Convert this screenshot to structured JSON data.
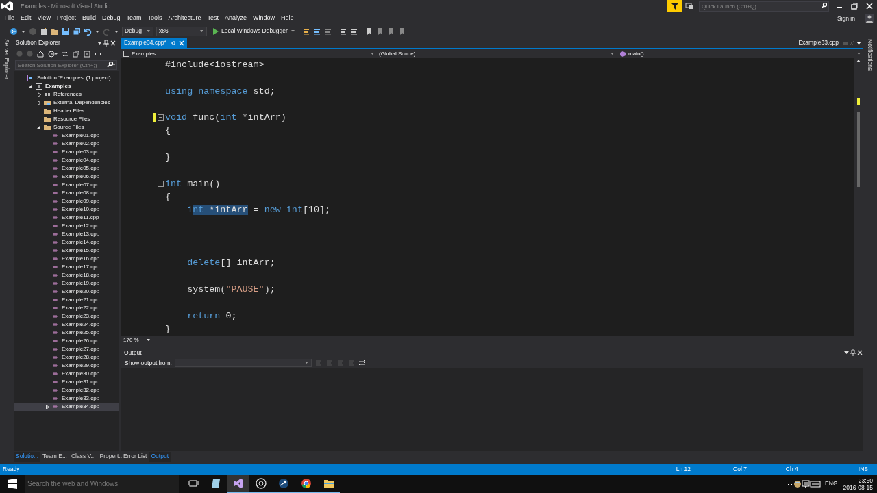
{
  "window": {
    "title": "Examples - Microsoft Visual Studio"
  },
  "quick_launch": {
    "placeholder": "Quick Launch (Ctrl+Q)"
  },
  "menu": [
    "File",
    "Edit",
    "View",
    "Project",
    "Build",
    "Debug",
    "Team",
    "Tools",
    "Architecture",
    "Test",
    "Analyze",
    "Window",
    "Help"
  ],
  "account": {
    "label": "Sign in"
  },
  "toolbar": {
    "configuration": "Debug",
    "platform": "x86",
    "debugger": "Local Windows Debugger"
  },
  "left_strip": {
    "label": "Server Explorer"
  },
  "right_strip": {
    "label": "Notifications"
  },
  "solution_explorer": {
    "title": "Solution Explorer",
    "search": {
      "placeholder": "Search Solution Explorer (Ctrl+;)"
    },
    "tree": [
      {
        "label": "Solution 'Examples' (1 project)",
        "kind": "solution",
        "selected": false,
        "children": [
          {
            "label": "Examples",
            "kind": "project",
            "expanded": true,
            "selected": false,
            "children": [
              {
                "label": "References",
                "kind": "references",
                "expanded": false,
                "selected": false
              },
              {
                "label": "External Dependencies",
                "kind": "dependencies",
                "expanded": false,
                "selected": false
              },
              {
                "label": "Header Files",
                "kind": "folder",
                "selected": false
              },
              {
                "label": "Resource Files",
                "kind": "folder",
                "selected": false
              },
              {
                "label": "Source Files",
                "kind": "folder",
                "expanded": true,
                "selected": false,
                "children": [
                  {
                    "label": "Example01.cpp",
                    "kind": "file",
                    "selected": false
                  },
                  {
                    "label": "Example02.cpp",
                    "kind": "file",
                    "selected": false
                  },
                  {
                    "label": "Example03.cpp",
                    "kind": "file",
                    "selected": false
                  },
                  {
                    "label": "Example04.cpp",
                    "kind": "file",
                    "selected": false
                  },
                  {
                    "label": "Example05.cpp",
                    "kind": "file",
                    "selected": false
                  },
                  {
                    "label": "Example06.cpp",
                    "kind": "file",
                    "selected": false
                  },
                  {
                    "label": "Example07.cpp",
                    "kind": "file",
                    "selected": false
                  },
                  {
                    "label": "Example08.cpp",
                    "kind": "file",
                    "selected": false
                  },
                  {
                    "label": "Example09.cpp",
                    "kind": "file",
                    "selected": false
                  },
                  {
                    "label": "Example10.cpp",
                    "kind": "file",
                    "selected": false
                  },
                  {
                    "label": "Example11.cpp",
                    "kind": "file",
                    "selected": false
                  },
                  {
                    "label": "Example12.cpp",
                    "kind": "file",
                    "selected": false
                  },
                  {
                    "label": "Example13.cpp",
                    "kind": "file",
                    "selected": false
                  },
                  {
                    "label": "Example14.cpp",
                    "kind": "file",
                    "selected": false
                  },
                  {
                    "label": "Example15.cpp",
                    "kind": "file",
                    "selected": false
                  },
                  {
                    "label": "Example16.cpp",
                    "kind": "file",
                    "selected": false
                  },
                  {
                    "label": "Example17.cpp",
                    "kind": "file",
                    "selected": false
                  },
                  {
                    "label": "Example18.cpp",
                    "kind": "file",
                    "selected": false
                  },
                  {
                    "label": "Example19.cpp",
                    "kind": "file",
                    "selected": false
                  },
                  {
                    "label": "Example20.cpp",
                    "kind": "file",
                    "selected": false
                  },
                  {
                    "label": "Example21.cpp",
                    "kind": "file",
                    "selected": false
                  },
                  {
                    "label": "Example22.cpp",
                    "kind": "file",
                    "selected": false
                  },
                  {
                    "label": "Example23.cpp",
                    "kind": "file",
                    "selected": false
                  },
                  {
                    "label": "Example24.cpp",
                    "kind": "file",
                    "selected": false
                  },
                  {
                    "label": "Example25.cpp",
                    "kind": "file",
                    "selected": false
                  },
                  {
                    "label": "Example26.cpp",
                    "kind": "file",
                    "selected": false
                  },
                  {
                    "label": "Example27.cpp",
                    "kind": "file",
                    "selected": false
                  },
                  {
                    "label": "Example28.cpp",
                    "kind": "file",
                    "selected": false
                  },
                  {
                    "label": "Example29.cpp",
                    "kind": "file",
                    "selected": false
                  },
                  {
                    "label": "Example30.cpp",
                    "kind": "file",
                    "selected": false
                  },
                  {
                    "label": "Example31.cpp",
                    "kind": "file",
                    "selected": false
                  },
                  {
                    "label": "Example32.cpp",
                    "kind": "file",
                    "selected": false
                  },
                  {
                    "label": "Example33.cpp",
                    "kind": "file",
                    "selected": false
                  },
                  {
                    "label": "Example34.cpp",
                    "kind": "file",
                    "expanded": false,
                    "selected": true
                  }
                ]
              }
            ]
          }
        ]
      }
    ]
  },
  "editor": {
    "tabs": [
      {
        "label": "Example34.cpp*",
        "selected": true
      }
    ],
    "preview_tab": {
      "label": "Example33.cpp"
    },
    "nav": {
      "project": "Examples",
      "scope": "(Global Scope)",
      "member": "main()"
    },
    "lines": [
      {
        "kind": "code",
        "tokens": [
          {
            "text": "#include<iostream>",
            "kind": "plain"
          }
        ]
      },
      {
        "kind": "blank"
      },
      {
        "kind": "code",
        "tokens": [
          {
            "text": "using namespace",
            "kind": "keyword"
          },
          {
            "text": " std;",
            "kind": "plain"
          }
        ]
      },
      {
        "kind": "blank"
      },
      {
        "kind": "code",
        "changed": true,
        "collapsible": true,
        "tokens": [
          {
            "text": "void",
            "kind": "keyword"
          },
          {
            "text": " func(",
            "kind": "plain"
          },
          {
            "text": "int",
            "kind": "keyword"
          },
          {
            "text": " *intArr)",
            "kind": "plain"
          }
        ]
      },
      {
        "kind": "code",
        "tokens": [
          {
            "text": "{",
            "kind": "plain"
          }
        ]
      },
      {
        "kind": "blank"
      },
      {
        "kind": "code",
        "tokens": [
          {
            "text": "}",
            "kind": "plain"
          }
        ]
      },
      {
        "kind": "blank"
      },
      {
        "kind": "code",
        "collapsible": true,
        "tokens": [
          {
            "text": "int",
            "kind": "keyword"
          },
          {
            "text": " main()",
            "kind": "plain"
          }
        ]
      },
      {
        "kind": "code",
        "tokens": [
          {
            "text": "{",
            "kind": "plain"
          }
        ]
      },
      {
        "kind": "code",
        "tokens": [
          {
            "text": "    i",
            "kind": "keyword"
          },
          {
            "text": "nt",
            "kind": "keyword",
            "selected": true
          },
          {
            "text": " *intArr",
            "kind": "plain",
            "selected": true
          },
          {
            "text": " = ",
            "kind": "plain"
          },
          {
            "text": "new int",
            "kind": "keyword"
          },
          {
            "text": "[10];",
            "kind": "plain"
          }
        ]
      },
      {
        "kind": "blank"
      },
      {
        "kind": "blank"
      },
      {
        "kind": "blank"
      },
      {
        "kind": "code",
        "tokens": [
          {
            "text": "    delete",
            "kind": "keyword"
          },
          {
            "text": "[] intArr;",
            "kind": "plain"
          }
        ]
      },
      {
        "kind": "blank"
      },
      {
        "kind": "code",
        "tokens": [
          {
            "text": "    system(",
            "kind": "plain"
          },
          {
            "text": "\"PAUSE\"",
            "kind": "string"
          },
          {
            "text": ");",
            "kind": "plain"
          }
        ]
      },
      {
        "kind": "blank"
      },
      {
        "kind": "code",
        "tokens": [
          {
            "text": "    return",
            "kind": "keyword"
          },
          {
            "text": " 0;",
            "kind": "plain"
          }
        ]
      },
      {
        "kind": "code",
        "tokens": [
          {
            "text": "}",
            "kind": "plain"
          }
        ]
      }
    ],
    "zoom": "170 %"
  },
  "output": {
    "title": "Output",
    "show_from_label": "Show output from:"
  },
  "left_tabs": [
    {
      "label": "Solutio...",
      "selected": true
    },
    {
      "label": "Team E...",
      "selected": false
    },
    {
      "label": "Class V...",
      "selected": false
    },
    {
      "label": "Propert...",
      "selected": false
    }
  ],
  "bottom_tabs": [
    {
      "label": "Error List",
      "selected": false
    },
    {
      "label": "Output",
      "selected": true
    }
  ],
  "status_bar": {
    "text": "Ready",
    "line": "Ln 12",
    "column": "Col 7",
    "char": "Ch 4",
    "mode": "INS"
  },
  "taskbar": {
    "search": {
      "placeholder": "Search the web and Windows"
    },
    "apps": [
      {
        "kind": "taskview",
        "running": false,
        "active": false
      },
      {
        "kind": "notepad",
        "running": false,
        "active": false
      },
      {
        "kind": "studio",
        "running": true,
        "active": true
      },
      {
        "kind": "recorder",
        "running": true,
        "active": false
      },
      {
        "kind": "steam",
        "running": true,
        "active": false
      },
      {
        "kind": "browser",
        "running": true,
        "active": false
      },
      {
        "kind": "folder",
        "running": true,
        "active": false
      }
    ],
    "language": "ENG",
    "time": "23:50",
    "date": "2016-08-15"
  }
}
